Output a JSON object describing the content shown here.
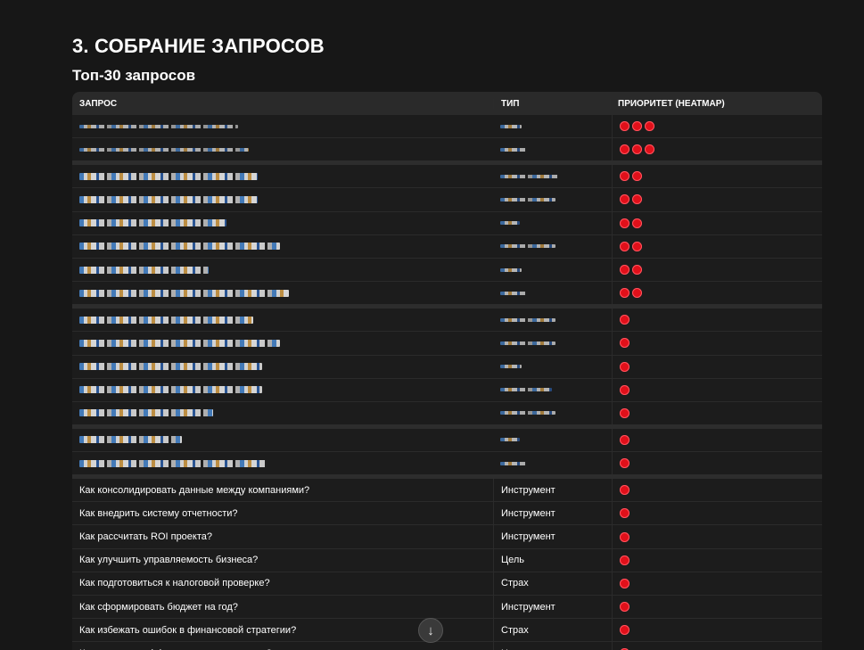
{
  "heading": {
    "title": "3. СОБРАНИЕ ЗАПРОСОВ",
    "subtitle": "Топ-30 запросов"
  },
  "table": {
    "columns": [
      "ЗАПРОС",
      "ТИП",
      "ПРИОРИТЕТ (HEATMAP)"
    ],
    "blurred_rows": [
      {
        "priority": 3
      },
      {
        "priority": 3
      },
      {
        "priority": 2
      },
      {
        "priority": 2
      },
      {
        "priority": 2
      },
      {
        "priority": 2
      },
      {
        "priority": 2
      },
      {
        "priority": 2
      },
      {
        "priority": 1
      },
      {
        "priority": 1
      },
      {
        "priority": 1
      },
      {
        "priority": 1
      },
      {
        "priority": 1
      },
      {
        "priority": 1
      },
      {
        "priority": 1
      }
    ],
    "rows": [
      {
        "query": "Как консолидировать данные между компаниями?",
        "type": "Инструмент",
        "priority": 1
      },
      {
        "query": "Как внедрить систему отчетности?",
        "type": "Инструмент",
        "priority": 1
      },
      {
        "query": "Как рассчитать ROI проекта?",
        "type": "Инструмент",
        "priority": 1
      },
      {
        "query": "Как улучшить управляемость бизнеса?",
        "type": "Цель",
        "priority": 1
      },
      {
        "query": "Как подготовиться к налоговой проверке?",
        "type": "Страх",
        "priority": 1
      },
      {
        "query": "Как сформировать бюджет на год?",
        "type": "Инструмент",
        "priority": 1
      },
      {
        "query": "Как избежать ошибок в финансовой стратегии?",
        "type": "Страх",
        "priority": 1
      },
      {
        "query": "Как повысить эффективность персонала?",
        "type": "Цель",
        "priority": 1
      }
    ]
  },
  "colors": {
    "priority_dot": "#e0101a",
    "background": "#171717"
  },
  "icons": {
    "scroll_down": "arrow-down-icon"
  }
}
